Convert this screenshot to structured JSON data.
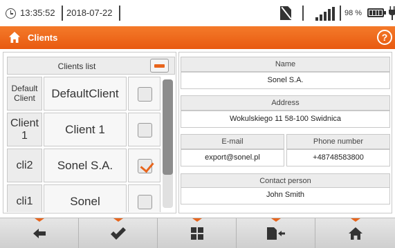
{
  "status_bar": {
    "time": "13:35:52",
    "date": "2018-07-22",
    "battery_percent": "98 %",
    "icons": [
      "clock-icon",
      "sdcard-missing-icon",
      "signal-strength-icon",
      "battery-icon",
      "power-plug-icon"
    ]
  },
  "title_bar": {
    "title": "Clients",
    "icons": [
      "home-icon",
      "help-icon"
    ]
  },
  "clients_list": {
    "header": "Clients list",
    "rows": [
      {
        "id": "Default Client",
        "name": "DefaultClient",
        "checked": false
      },
      {
        "id": "Client 1",
        "name": "Client 1",
        "checked": false
      },
      {
        "id": "cli2",
        "name": "Sonel S.A.",
        "checked": true
      },
      {
        "id": "cli1",
        "name": "Sonel",
        "checked": false
      }
    ]
  },
  "details": {
    "name_label": "Name",
    "name_value": "Sonel S.A.",
    "address_label": "Address",
    "address_value": "Wokulskiego 11 58-100 Swidnica",
    "email_label": "E-mail",
    "email_value": "export@sonel.pl",
    "phone_label": "Phone number",
    "phone_value": "+48748583800",
    "contact_label": "Contact person",
    "contact_value": "John Smith"
  },
  "toolbar": {
    "buttons": [
      "back-arrow-icon",
      "confirm-check-icon",
      "grid-menu-icon",
      "memory-card-export-icon",
      "home-icon"
    ]
  },
  "colors": {
    "accent": "#e8651c",
    "title_bar": "#f06b1e"
  }
}
